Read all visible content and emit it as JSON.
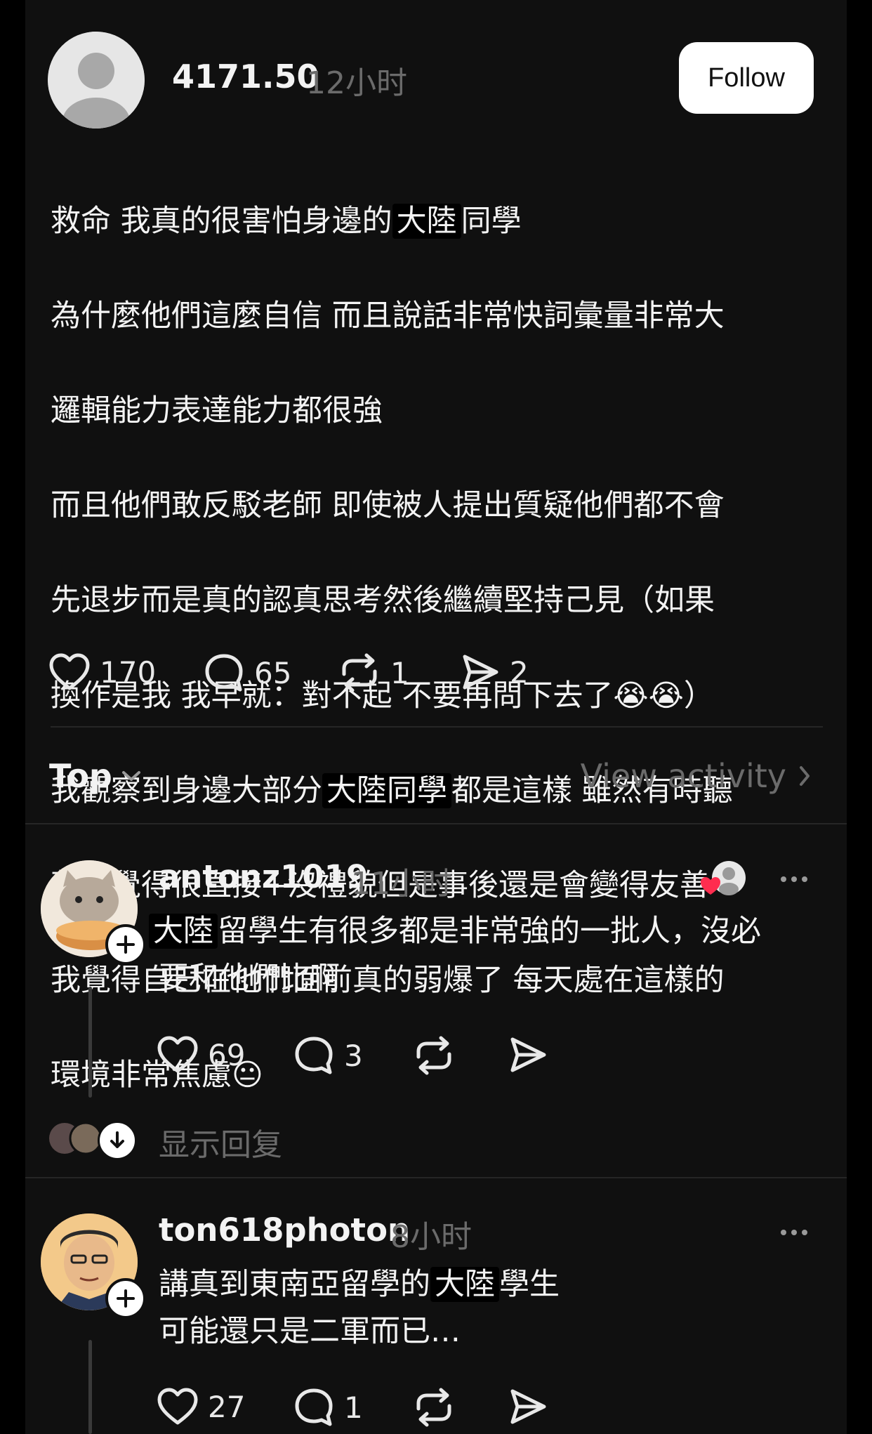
{
  "post": {
    "username": "4171.50",
    "time": "12小时",
    "follow_label": "Follow",
    "lines": [
      [
        "救命 我真的很害怕身邊的",
        "大陸",
        "同學"
      ],
      [
        "為什麼他們這麼自信 而且說話非常快詞彙量非常大"
      ],
      [
        "邏輯能力表達能力都很強"
      ],
      [
        "而且他們敢反駁老師 即使被人提出質疑他們都不會"
      ],
      [
        "先退步而是真的認真思考然後繼續堅持己見（如果"
      ],
      [
        "換作是我 我早就：對不起 不要再問下去了😭😭）"
      ],
      [
        "我觀察到身邊大部分",
        "大陸同學",
        "都是這樣 雖然有時聽"
      ],
      [
        "著會覺得很直接+沒禮貌但是事後還是會變得友善"
      ],
      [
        "我覺得自己在他們面前真的弱爆了 每天處在這樣的"
      ],
      [
        "環境非常焦慮😐"
      ]
    ],
    "likes": "170",
    "comments": "65",
    "reposts": "1",
    "shares": "2"
  },
  "sort": {
    "label": "Top",
    "view_activity": "View activity"
  },
  "comments": [
    {
      "username": "antonz1019",
      "time": "11小时",
      "text_hl": "大陸",
      "text_line1_rest": "留學生有很多都是非常強的一批人，沒必",
      "text_line2": "要和他們比啊",
      "likes": "69",
      "replies": "3",
      "show_replies": "显示回复"
    },
    {
      "username": "ton618photon",
      "time": "8小时",
      "text_line1_pre": "講真到東南亞留學的",
      "text_hl": "大陸",
      "text_line1_post": "學生",
      "text_line2": "可能還只是二軍而已…",
      "likes": "27",
      "replies": "1"
    }
  ]
}
